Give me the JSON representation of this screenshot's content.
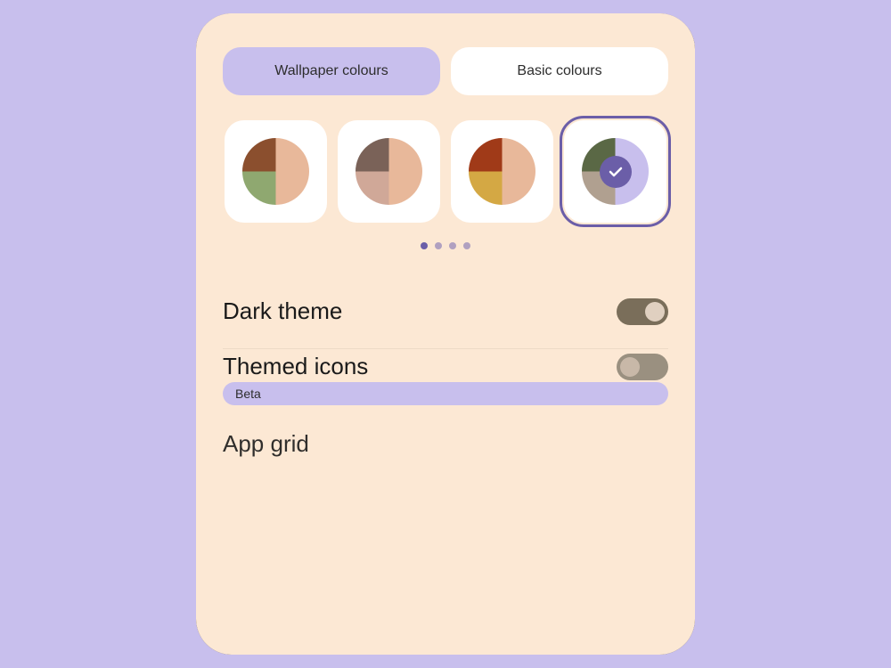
{
  "background": "#c8bfed",
  "tabs": {
    "wallpaper": {
      "label": "Wallpaper colours",
      "active": true,
      "bg": "#c8bfed"
    },
    "basic": {
      "label": "Basic colours",
      "active": false,
      "bg": "#ffffff"
    }
  },
  "swatches": [
    {
      "id": 1,
      "selected": false,
      "pie_class": "pie-1"
    },
    {
      "id": 2,
      "selected": false,
      "pie_class": "pie-2"
    },
    {
      "id": 3,
      "selected": false,
      "pie_class": "pie-3"
    },
    {
      "id": 4,
      "selected": true,
      "pie_class": "pie-4"
    }
  ],
  "dots": [
    {
      "active": true
    },
    {
      "active": false
    },
    {
      "active": false
    },
    {
      "active": false
    }
  ],
  "settings": {
    "dark_theme": {
      "label": "Dark theme",
      "enabled": true
    },
    "themed_icons": {
      "label": "Themed icons",
      "enabled": false,
      "badge": "Beta"
    }
  },
  "footer": {
    "label": "App grid"
  }
}
